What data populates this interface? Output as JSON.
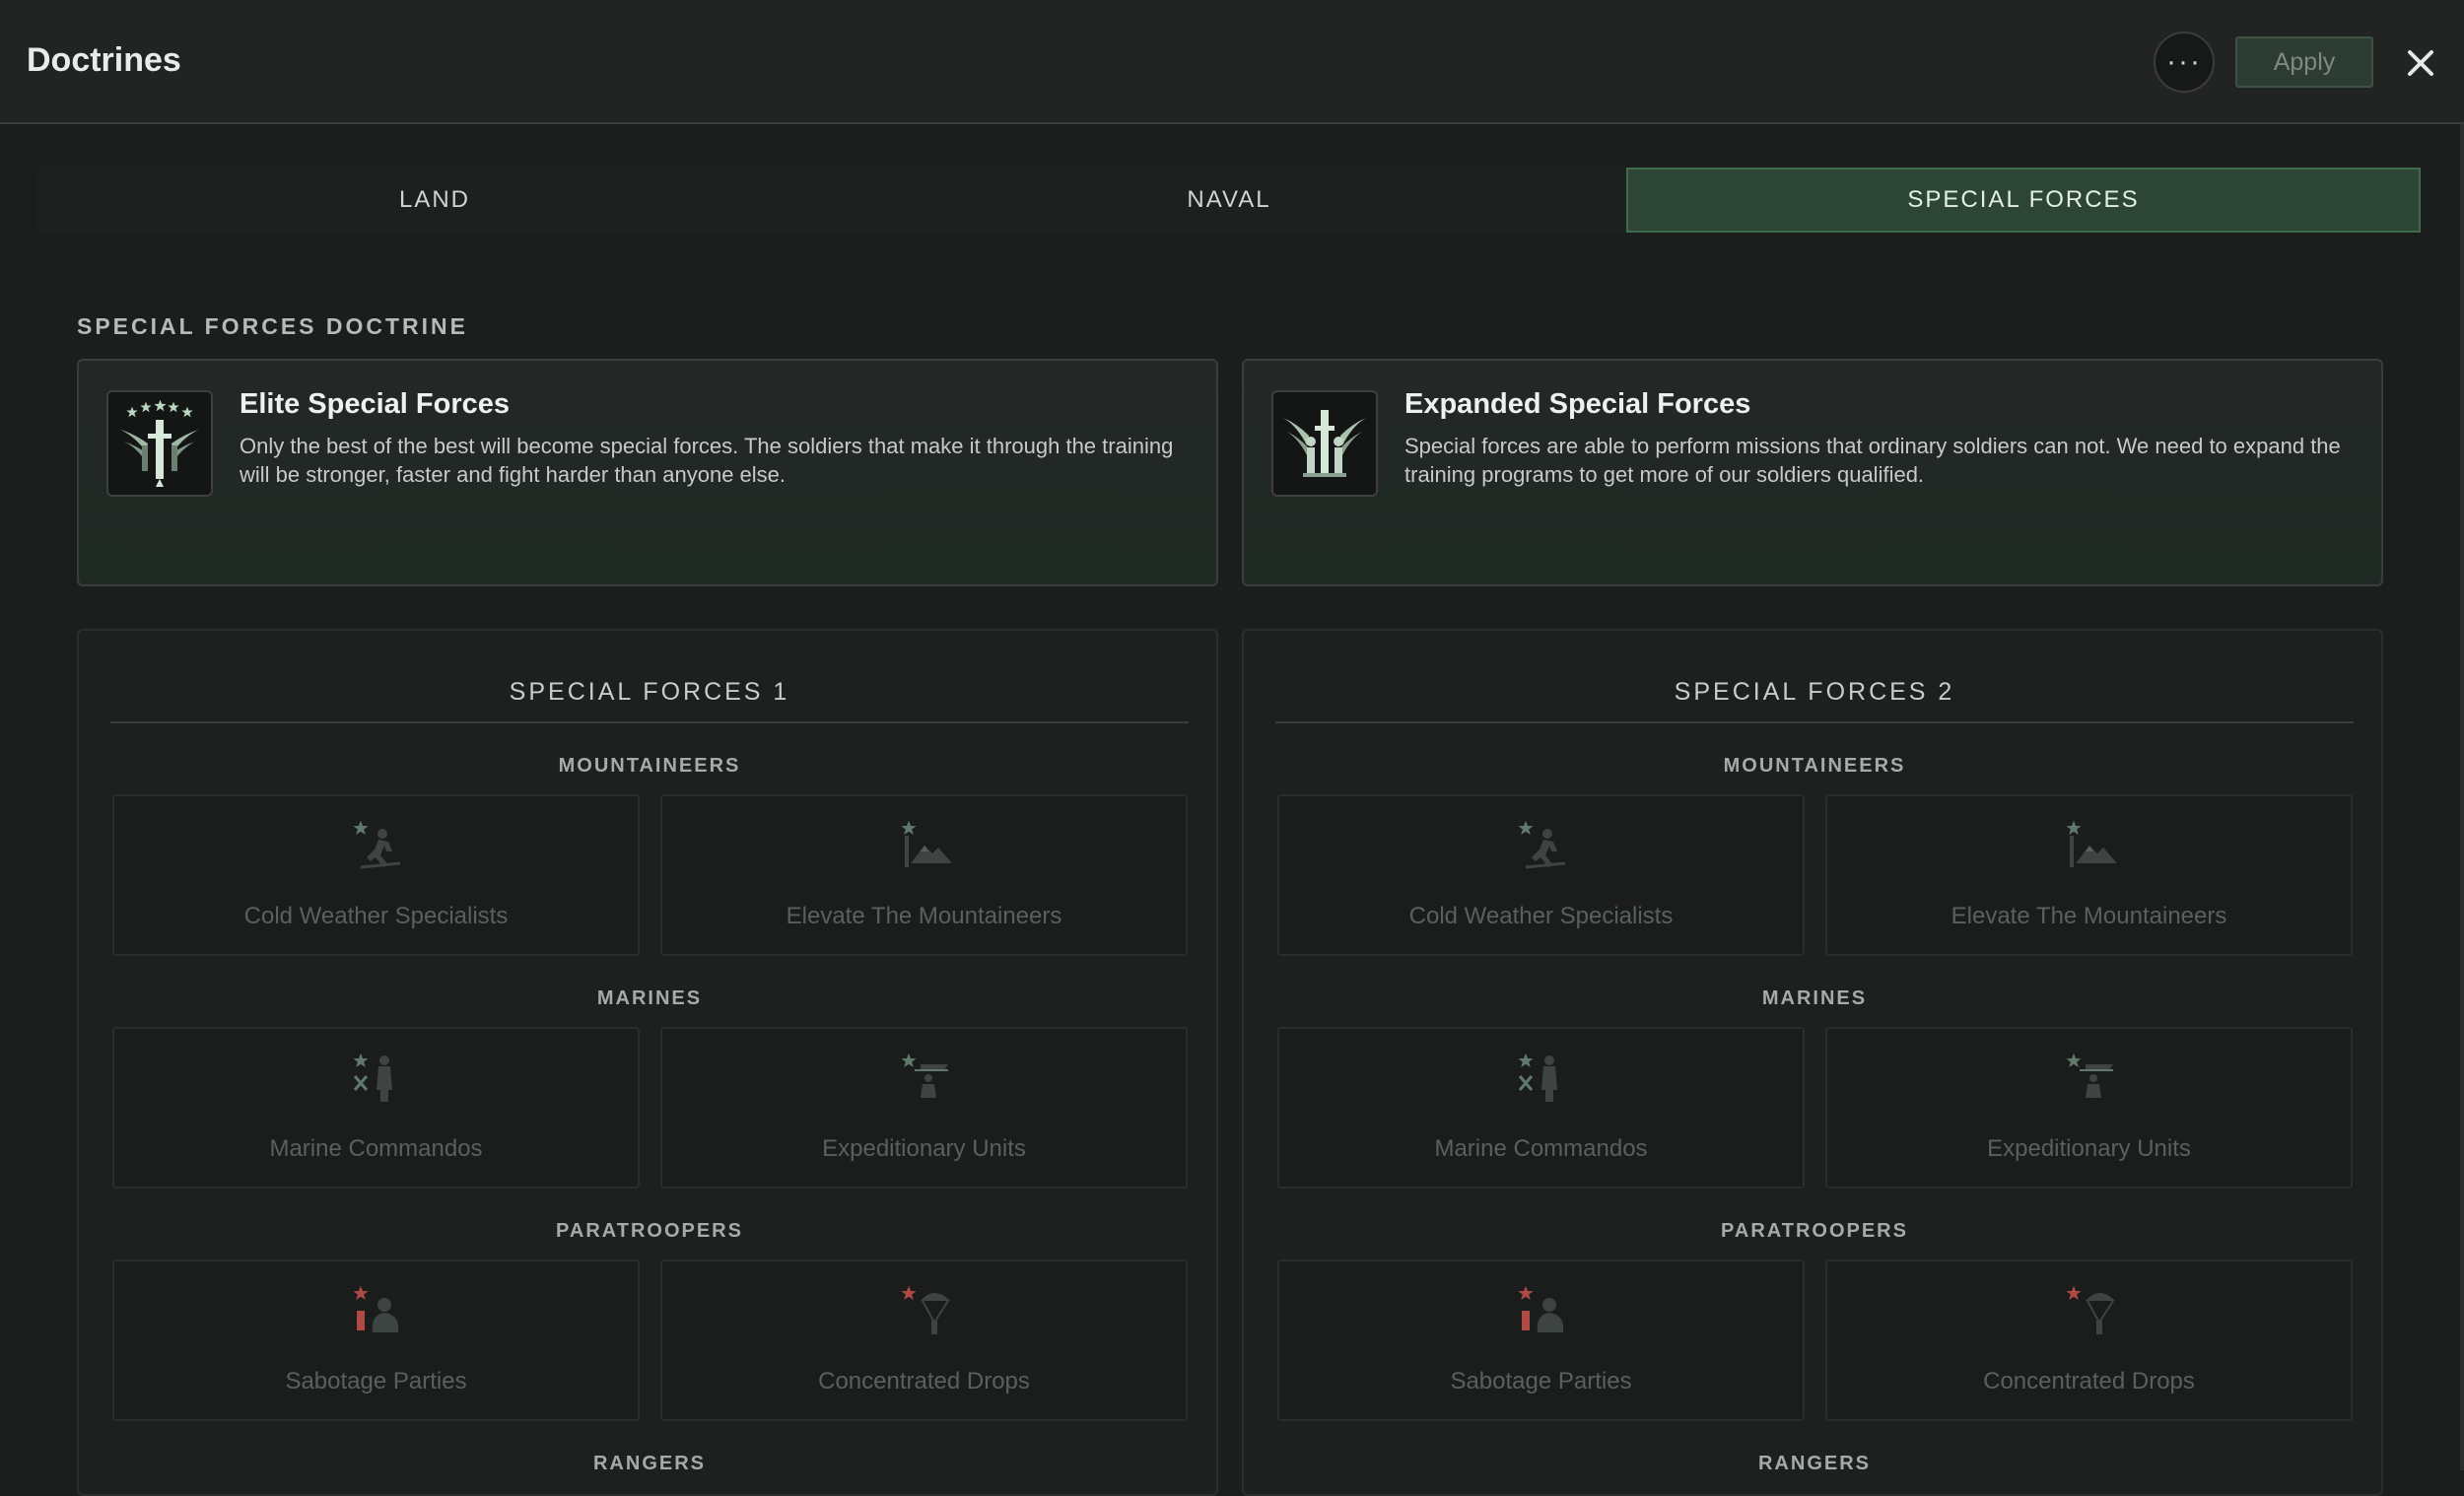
{
  "header": {
    "title": "Doctrines",
    "more_label": "···",
    "apply_label": "Apply"
  },
  "tabs": [
    {
      "label": "LAND",
      "active": false
    },
    {
      "label": "NAVAL",
      "active": false
    },
    {
      "label": "SPECIAL FORCES",
      "active": true
    }
  ],
  "doctrine_section": {
    "label": "SPECIAL FORCES DOCTRINE",
    "cards": [
      {
        "name": "Elite Special Forces",
        "description": "Only the best of the best will become special forces. The soldiers that make it through the training will be stronger, faster and fight harder than anyone else.",
        "icon": "winged-dagger-stars-emblem"
      },
      {
        "name": "Expanded Special Forces",
        "description": "Special forces are able to perform missions that ordinary soldiers can not. We need to expand the training programs to get more of our soldiers qualified.",
        "icon": "winged-soldiers-emblem"
      }
    ]
  },
  "groups": [
    {
      "title": "SPECIAL FORCES 1",
      "categories": [
        {
          "label": "MOUNTAINEERS",
          "items": [
            {
              "name": "Cold Weather Specialists",
              "icon": "skier-soldier-icon"
            },
            {
              "name": "Elevate The Mountaineers",
              "icon": "mountain-icon"
            }
          ]
        },
        {
          "label": "MARINES",
          "items": [
            {
              "name": "Marine Commandos",
              "icon": "commando-icon"
            },
            {
              "name": "Expeditionary Units",
              "icon": "landing-ship-icon"
            }
          ]
        },
        {
          "label": "PARATROOPERS",
          "items": [
            {
              "name": "Sabotage Parties",
              "icon": "saboteur-icon"
            },
            {
              "name": "Concentrated Drops",
              "icon": "parachute-icon"
            }
          ]
        },
        {
          "label": "RANGERS",
          "items": []
        }
      ]
    },
    {
      "title": "SPECIAL FORCES 2",
      "categories": [
        {
          "label": "MOUNTAINEERS",
          "items": [
            {
              "name": "Cold Weather Specialists",
              "icon": "skier-soldier-icon"
            },
            {
              "name": "Elevate The Mountaineers",
              "icon": "mountain-icon"
            }
          ]
        },
        {
          "label": "MARINES",
          "items": [
            {
              "name": "Marine Commandos",
              "icon": "commando-icon"
            },
            {
              "name": "Expeditionary Units",
              "icon": "landing-ship-icon"
            }
          ]
        },
        {
          "label": "PARATROOPERS",
          "items": [
            {
              "name": "Sabotage Parties",
              "icon": "saboteur-icon"
            },
            {
              "name": "Concentrated Drops",
              "icon": "parachute-icon"
            }
          ]
        },
        {
          "label": "RANGERS",
          "items": []
        }
      ]
    }
  ],
  "colors": {
    "accent_green": "#2d4534",
    "star_grey": "#5f7a6c",
    "star_red": "#b04a44"
  }
}
